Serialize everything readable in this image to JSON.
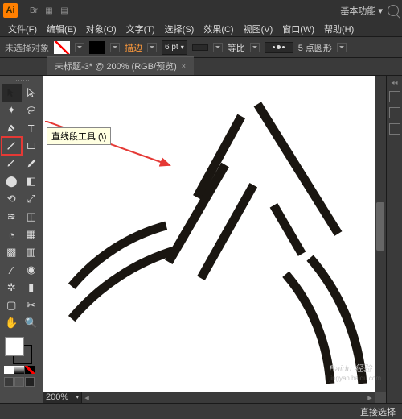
{
  "app": {
    "logo": "Ai",
    "workspace": "基本功能 ▾"
  },
  "menu": {
    "file": "文件(F)",
    "edit": "编辑(E)",
    "object": "对象(O)",
    "type": "文字(T)",
    "select": "选择(S)",
    "effect": "效果(C)",
    "view": "视图(V)",
    "window": "窗口(W)",
    "help": "帮助(H)"
  },
  "control": {
    "noselection": "未选择对象",
    "stroke_label": "描边",
    "stroke_pt": "6 pt",
    "uniform": "等比",
    "profile": "5 点圆形"
  },
  "doc": {
    "tab": "未标题-3* @ 200% (RGB/预览)",
    "close": "×"
  },
  "tooltip": {
    "text": "直线段工具 (\\)"
  },
  "status": {
    "zoom": "200%",
    "mode": "直接选择"
  },
  "watermark": {
    "main": "Baidu 经验",
    "sub": "jingyan.baidu.com"
  }
}
